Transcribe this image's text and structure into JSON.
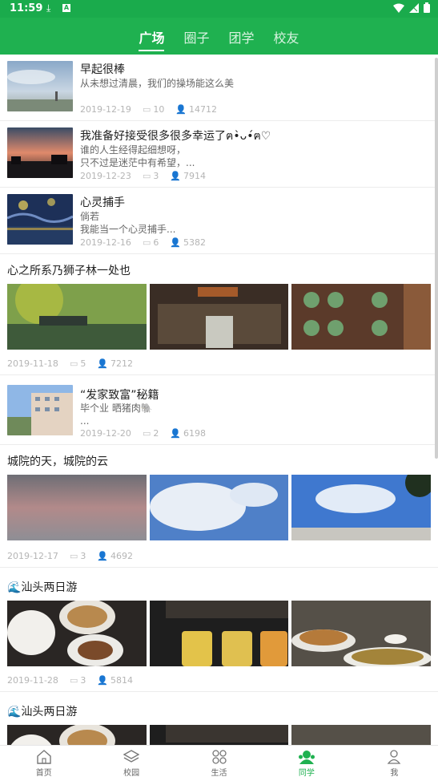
{
  "status": {
    "time": "11:59",
    "download_icon": "download-icon",
    "app_icon": "a-icon"
  },
  "tabs": [
    {
      "label": "广场",
      "active": true
    },
    {
      "label": "圈子",
      "active": false
    },
    {
      "label": "团学",
      "active": false
    },
    {
      "label": "校友",
      "active": false
    }
  ],
  "posts": [
    {
      "title": "早起很棒",
      "desc1": "从未想过清晨，我们的操场能这么美",
      "desc2": "",
      "date": "2019-12-19",
      "comments": "10",
      "views": "14712"
    },
    {
      "title": "我准备好接受很多很多幸运了ฅ•̀ᴗ•́ฅ♡",
      "desc1": "谁的人生经得起细想呀，",
      "desc2": "只不过是迷茫中有希望，...",
      "date": "2019-12-23",
      "comments": "3",
      "views": "7914"
    },
    {
      "title": "心灵捕手",
      "desc1": "倘若",
      "desc2": "我能当一个心灵捕手...",
      "date": "2019-12-16",
      "comments": "6",
      "views": "5382"
    },
    {
      "title": "心之所系乃狮子林一处也",
      "date": "2019-11-18",
      "comments": "5",
      "views": "7212"
    },
    {
      "title": "“发家致富”秘籍",
      "desc1": "毕个业  晒猪肉🐘",
      "desc2": "...",
      "date": "2019-12-20",
      "comments": "2",
      "views": "6198"
    },
    {
      "title": "城院的天，城院的云",
      "date": "2019-12-17",
      "comments": "3",
      "views": "4692"
    },
    {
      "title": "🌊汕头两日游",
      "date": "2019-11-28",
      "comments": "3",
      "views": "5814"
    },
    {
      "title": "🌊汕头两日游"
    }
  ],
  "nav": [
    {
      "label": "首页",
      "icon": "home-icon"
    },
    {
      "label": "校园",
      "icon": "layers-icon"
    },
    {
      "label": "生活",
      "icon": "grid-icon"
    },
    {
      "label": "同学",
      "icon": "classmates-icon",
      "active": true
    },
    {
      "label": "我",
      "icon": "person-icon"
    }
  ],
  "colors": {
    "brand": "#1fb150",
    "status_bar": "#1aab4c"
  }
}
